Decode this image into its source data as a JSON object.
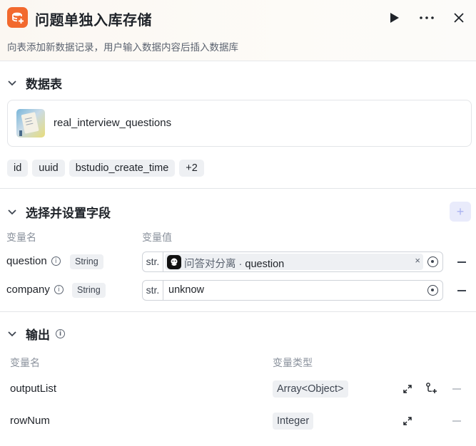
{
  "header": {
    "title": "问题单独入库存储",
    "description": "向表添加新数据记录，用户输入数据内容后插入数据库",
    "icon": "database-add-icon",
    "accent": "#f2692e"
  },
  "table_section": {
    "title": "数据表",
    "table_name": "real_interview_questions",
    "fields": [
      "id",
      "uuid",
      "bstudio_create_time",
      "+2"
    ]
  },
  "fields_section": {
    "title": "选择并设置字段",
    "col_name": "变量名",
    "col_value": "变量值",
    "add_label": "+",
    "rows": [
      {
        "name": "question",
        "type": "String",
        "prefix": "str.",
        "ref_source": "问答对分离",
        "ref_sep": " · ",
        "ref_var": "question",
        "clear": "×"
      },
      {
        "name": "company",
        "type": "String",
        "prefix": "str.",
        "value": "unknow"
      }
    ]
  },
  "output_section": {
    "title": "输出",
    "col_name": "变量名",
    "col_type": "变量类型",
    "rows": [
      {
        "name": "outputList",
        "type": "Array<Object>"
      },
      {
        "name": "rowNum",
        "type": "Integer"
      }
    ]
  }
}
